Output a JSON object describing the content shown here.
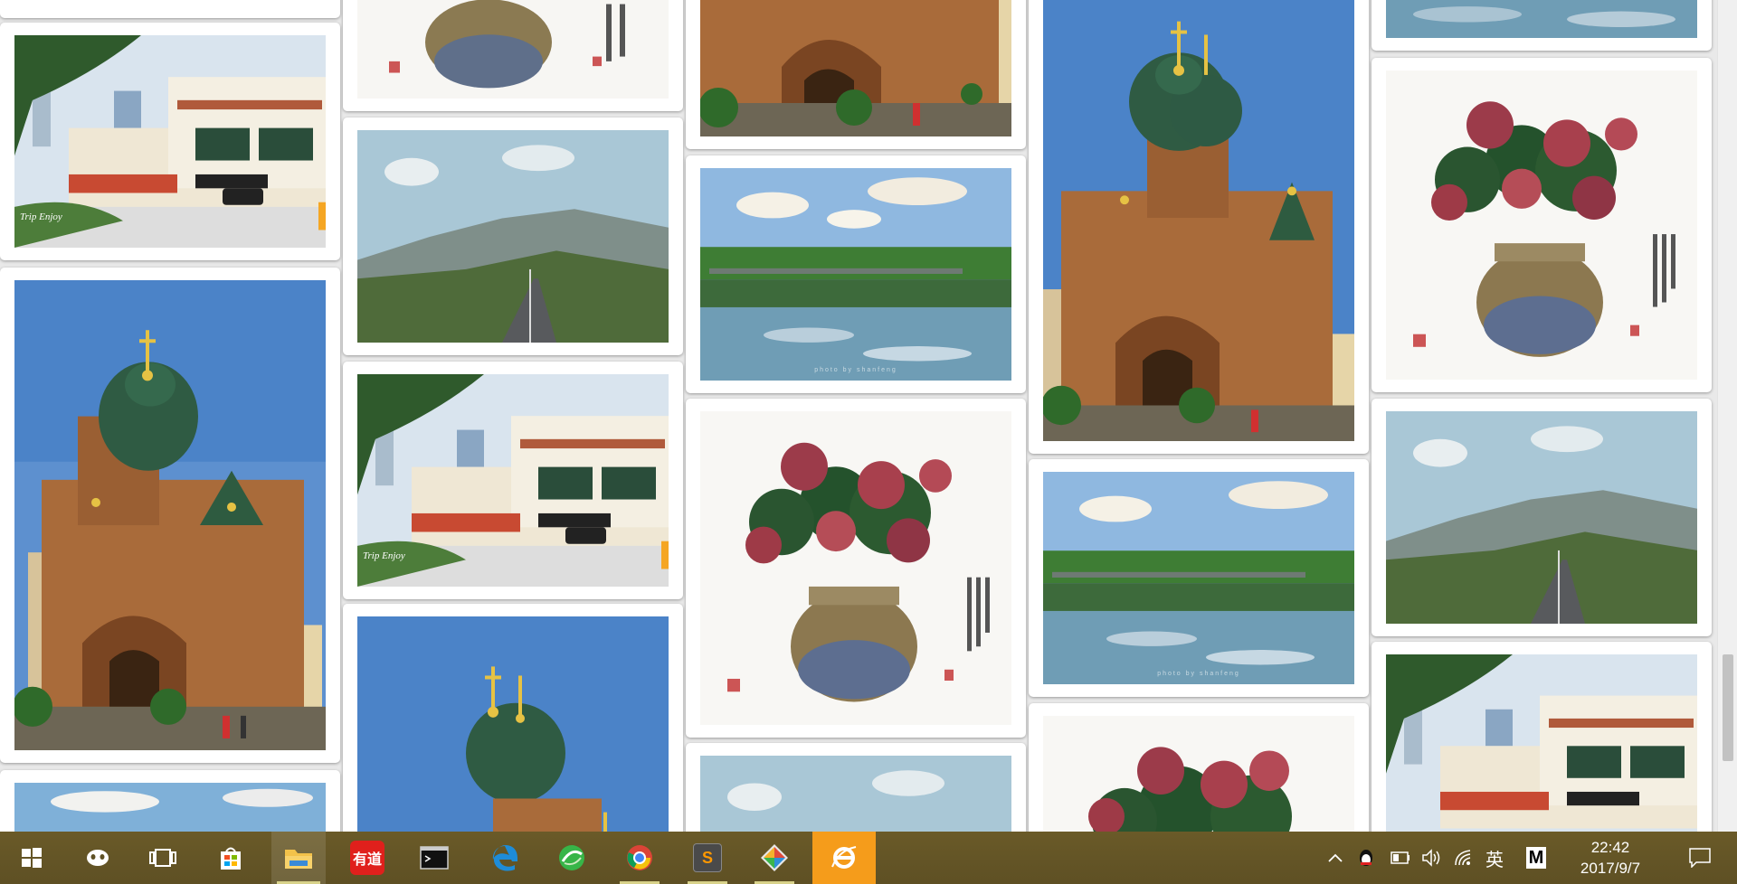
{
  "gallery": {
    "photos": [
      {
        "subject": "street",
        "caption": "Trip Enjoy"
      },
      {
        "subject": "cathedral"
      },
      {
        "subject": "lake"
      },
      {
        "subject": "vase"
      },
      {
        "subject": "road"
      },
      {
        "subject": "street",
        "caption": "Trip Enjoy"
      },
      {
        "subject": "cathedral"
      },
      {
        "subject": "cathedral"
      },
      {
        "subject": "lake",
        "watermark": "photo by shanfeng"
      },
      {
        "subject": "vase"
      },
      {
        "subject": "road"
      },
      {
        "subject": "cathedral"
      },
      {
        "subject": "lake",
        "watermark": "photo by shanfeng"
      },
      {
        "subject": "vase"
      },
      {
        "subject": "lake"
      },
      {
        "subject": "vase"
      },
      {
        "subject": "road"
      },
      {
        "subject": "street"
      }
    ]
  },
  "taskbar": {
    "apps": [
      {
        "name": "start",
        "icon": "windows-logo-icon"
      },
      {
        "name": "cortana",
        "icon": "cortana-icon"
      },
      {
        "name": "task-view",
        "icon": "task-view-icon"
      },
      {
        "name": "store",
        "icon": "store-bag-icon"
      },
      {
        "name": "file-explorer",
        "icon": "folder-icon"
      },
      {
        "name": "youdao",
        "icon": "youdao-icon",
        "label": "有道"
      },
      {
        "name": "terminal",
        "icon": "terminal-icon"
      },
      {
        "name": "edge",
        "icon": "edge-icon"
      },
      {
        "name": "browser-360",
        "icon": "browser-360-icon"
      },
      {
        "name": "chrome",
        "icon": "chrome-icon"
      },
      {
        "name": "sublime",
        "icon": "sublime-icon",
        "label": "S"
      },
      {
        "name": "app-diamond",
        "icon": "diamond-app-icon"
      },
      {
        "name": "internet-explorer",
        "icon": "ie-icon"
      }
    ],
    "tray": {
      "ime_label": "英",
      "m_label": "M",
      "time": "22:42",
      "date": "2017/9/7"
    }
  },
  "colors": {
    "taskbar": "#5e5024",
    "page_bg": "#e9e9e9",
    "ie_accent": "#f59c1b"
  }
}
